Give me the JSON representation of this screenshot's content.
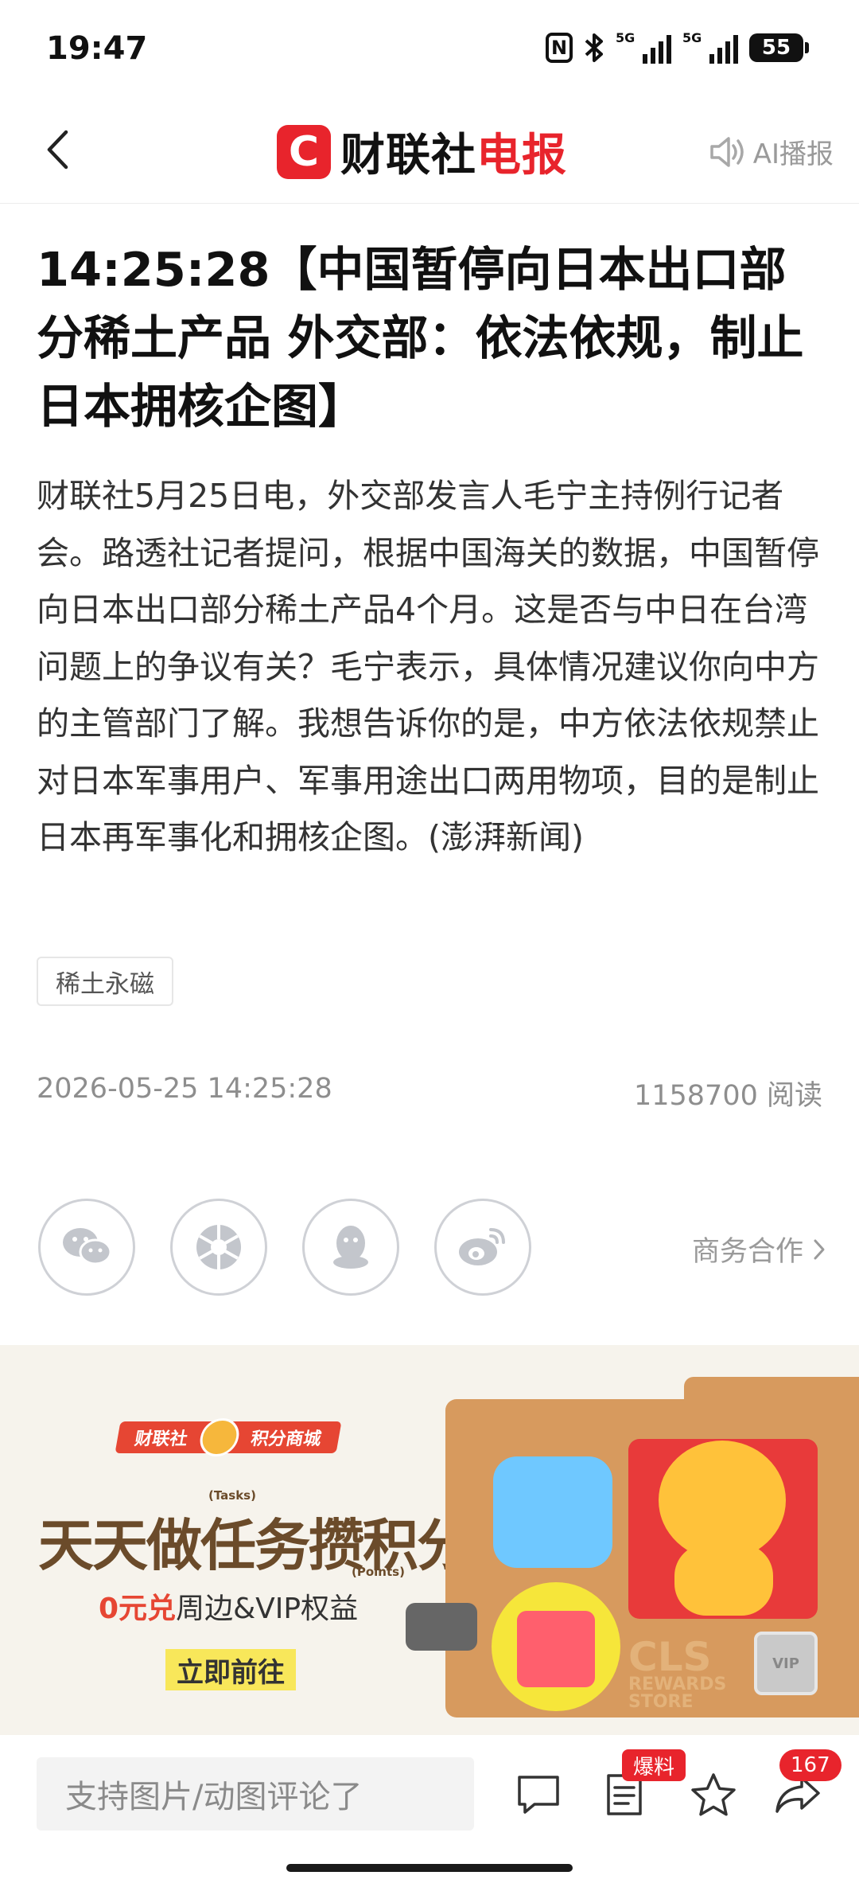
{
  "status_bar": {
    "time": "19:47",
    "net1": "5G",
    "net2": "5G",
    "battery": "55"
  },
  "header": {
    "logo_mark": "C",
    "logo_text_black": "财联社",
    "logo_text_red": "电报",
    "ai_play_label": "AI播报"
  },
  "article": {
    "headline": "14:25:28【中国暂停向日本出口部分稀土产品 外交部：依法依规，制止日本拥核企图】",
    "body": "财联社5月25日电，外交部发言人毛宁主持例行记者会。路透社记者提问，根据中国海关的数据，中国暂停向日本出口部分稀土产品4个月。这是否与中日在台湾问题上的争议有关？毛宁表示，具体情况建议你向中方的主管部门了解。我想告诉你的是，中方依法依规禁止对日本军事用户、军事用途出口两用物项，目的是制止日本再军事化和拥核企图。(澎湃新闻)",
    "tag": "稀土永磁",
    "date": "2026-05-25 14:25:28",
    "reads": "1158700 阅读"
  },
  "share": {
    "business_label": "商务合作"
  },
  "banner": {
    "brand_left": "财联社",
    "brand_right": "积分商城",
    "tasks_label": "(Tasks)",
    "headline": "天天做任务攒积分",
    "points_label": "(Points)",
    "sub_red": "0元兑",
    "sub_rest": "周边&VIP权益",
    "cta": "立即前往",
    "cls_logo": "CLS",
    "cls_sub1": "REWARDS",
    "cls_sub2": "STORE",
    "vip": "VIP"
  },
  "bottom_bar": {
    "comment_placeholder": "支持图片/动图评论了",
    "baoliao_badge": "爆料",
    "share_count": "167"
  }
}
